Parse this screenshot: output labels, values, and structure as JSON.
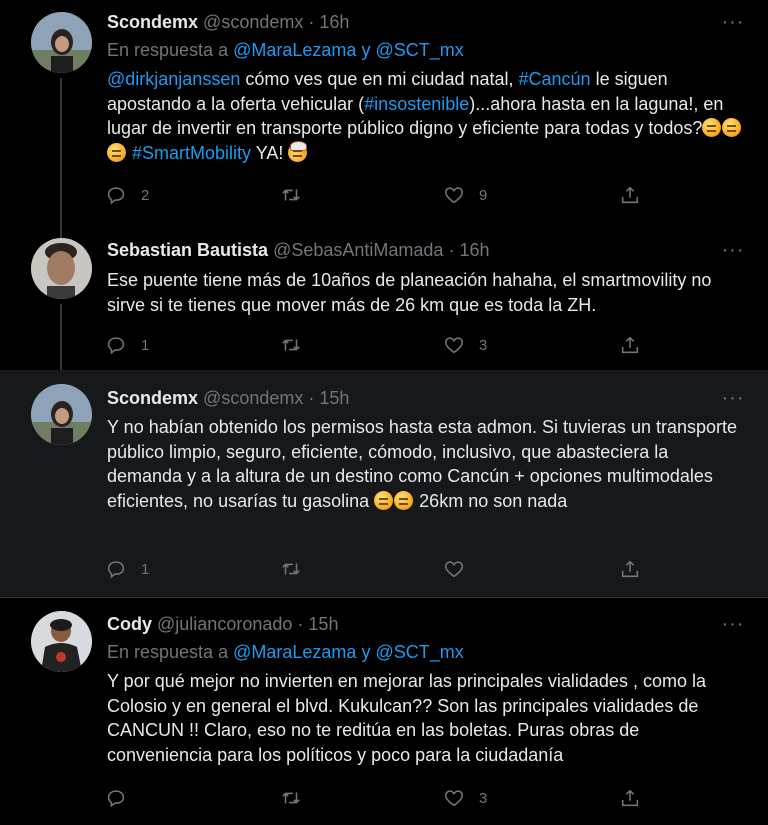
{
  "tweets": [
    {
      "name": "Scondemx",
      "handle": "@scondemx",
      "time": "16h",
      "reply_prefix": "En respuesta a",
      "reply_mention1": "@MaraLezama",
      "reply_and": "y",
      "reply_mention2": "@SCT_mx",
      "text_parts": {
        "mention": "@dirkjanjanssen",
        "p1": " cómo ves que en mi ciudad natal, ",
        "tag1": "#Cancún",
        "p2": " le siguen apostando a la oferta vehicular (",
        "tag2": "#insostenible",
        "p3": ")...ahora hasta en la laguna!, en lugar de invertir en transporte público digno y eficiente para todas y todos?",
        "tag3": "#SmartMobility",
        "p4": " YA! "
      },
      "replies": "2",
      "retweets": "",
      "likes": "9"
    },
    {
      "name": "Sebastian Bautista",
      "handle": "@SebasAntiMamada",
      "time": "16h",
      "text": "Ese puente tiene más de 10años de planeación hahaha, el smartmovility no sirve si te tienes que mover más de 26 km que es toda la ZH.",
      "replies": "1",
      "retweets": "",
      "likes": "3"
    },
    {
      "name": "Scondemx",
      "handle": "@scondemx",
      "time": "15h",
      "text": "Y no habían obtenido los permisos hasta esta admon. Si tuvieras un transporte público limpio, seguro, eficiente, cómodo, inclusivo, que abasteciera la demanda y a la altura de un destino como Cancún + opciones multimodales eficientes, no usarías tu gasolina ",
      "text_tail": " 26km no son nada",
      "replies": "1",
      "retweets": "",
      "likes": ""
    },
    {
      "name": "Cody",
      "handle": "@juliancoronado",
      "time": "15h",
      "reply_prefix": "En respuesta a",
      "reply_mention1": "@MaraLezama",
      "reply_and": "y",
      "reply_mention2": "@SCT_mx",
      "text": "Y por qué mejor no invierten en mejorar las principales vialidades , como la Colosio y en general el blvd. Kukulcan?? Son las principales vialidades de CANCUN !! Claro, eso no te reditúa en las boletas. Puras obras de conveniencia para los políticos y poco para la ciudadanía",
      "replies": "",
      "retweets": "",
      "likes": "3"
    }
  ],
  "ui": {
    "separator": "·",
    "more": "···"
  },
  "icons": [
    "reply-icon",
    "retweet-icon",
    "like-icon",
    "share-icon",
    "more-icon"
  ],
  "colors": {
    "background": "#000000",
    "text": "#e7e9ea",
    "secondary": "#71767b",
    "link": "#1d9bf0"
  }
}
